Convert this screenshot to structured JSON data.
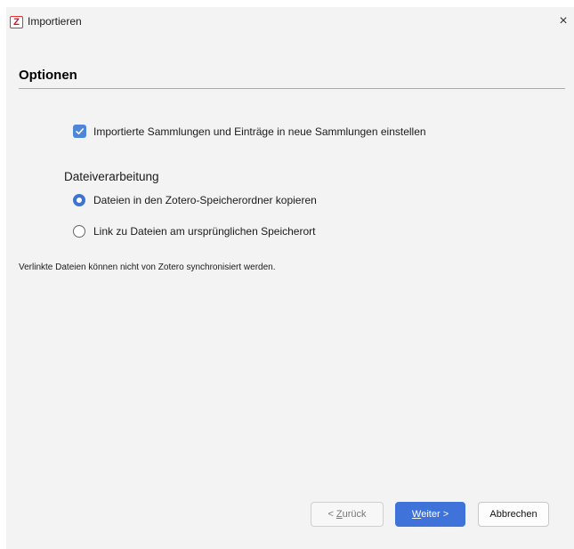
{
  "window": {
    "title": "Importieren",
    "app_icon_letter": "Z",
    "close_glyph": "×"
  },
  "page": {
    "header": "Optionen"
  },
  "options": {
    "collections_checkbox": {
      "label": "Importierte Sammlungen und Einträge in neue Sammlungen einstellen",
      "checked": true
    },
    "file_handling": {
      "label": "Dateiverarbeitung",
      "radios": [
        {
          "label": "Dateien in den Zotero-Speicherordner kopieren",
          "selected": true
        },
        {
          "label": "Link zu Dateien am ursprünglichen Speicherort",
          "selected": false
        }
      ]
    },
    "note": "Verlinkte Dateien können nicht von Zotero synchronisiert werden."
  },
  "buttons": {
    "back": {
      "prefix": "< ",
      "underlined": "Z",
      "rest": "urück",
      "enabled": false
    },
    "next": {
      "underlined": "W",
      "rest": "eiter >"
    },
    "cancel": "Abbrechen"
  },
  "colors": {
    "accent": "#3f73d9",
    "window_bg": "#f3f3f3"
  }
}
